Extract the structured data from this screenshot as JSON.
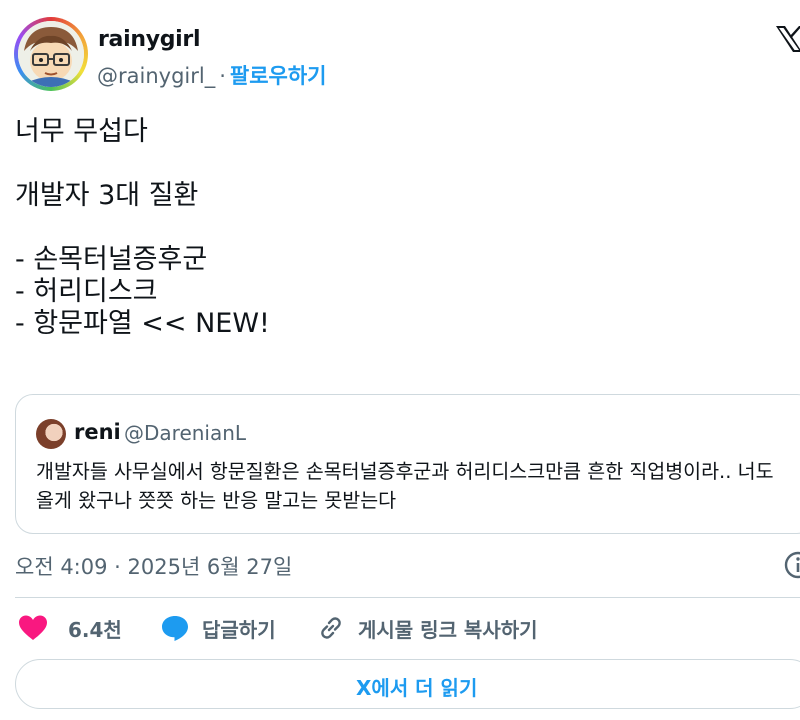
{
  "author": {
    "name": "rainygirl",
    "handle": "@rainygirl_",
    "separator": "·",
    "follow_label": "팔로우하기"
  },
  "tweet": {
    "text": "너무 무섭다\n\n개발자 3대 질환\n\n- 손목터널증후군\n- 허리디스크\n- 항문파열 << NEW!"
  },
  "quote": {
    "name": "reni",
    "handle": "@DarenianL",
    "text": "개발자들 사무실에서 항문질환은 손목터널증후군과 허리디스크만큼 흔한 직업병이라.. 너도 올게 왔구나 쯧쯧 하는 반응 말고는 못받는다"
  },
  "timestamp": "오전 4:09 · 2025년 6월 27일",
  "actions": {
    "like_count": "6.4천",
    "reply_label": "답글하기",
    "copy_link_label": "게시물 링크 복사하기"
  },
  "read_more_label": "X에서 더 읽기",
  "icons": [
    "x-logo-icon",
    "info-icon",
    "heart-icon",
    "speech-bubble-icon",
    "link-icon"
  ],
  "colors": {
    "accent": "#1d9bf0",
    "like": "#f91880",
    "muted_text": "#536471",
    "border": "#cfd9de"
  }
}
